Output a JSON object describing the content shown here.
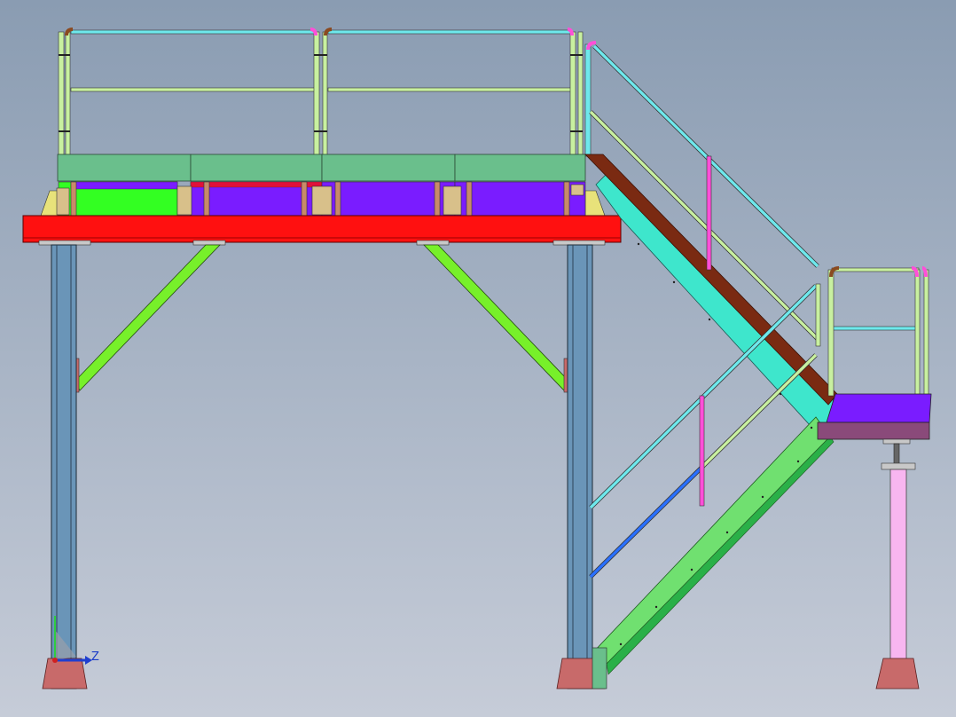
{
  "viewport": {
    "background_top": "#8a9cb2",
    "background_bottom": "#c6ccd8"
  },
  "triad": {
    "z_label": "Z",
    "y_color": "#2ecc40",
    "z_color": "#1f3fd0",
    "origin_color": "#d02020"
  },
  "colors": {
    "main_beam": "#ff1010",
    "column": "#6a95b8",
    "brace": "#77f02a",
    "deck_plate": "#6abf8c",
    "joist_purple": "#7a1cff",
    "joist_green": "#33ff22",
    "stair_stringer_brown": "#7a2a12",
    "stair_stringer_cyan": "#3ee6cc",
    "stair_stringer_green": "#70e070",
    "landing_purple": "#7a1cff",
    "landing_mauve": "#8a4a7a",
    "landing_post": "#f8b6f0",
    "handrail_light": "#c8f0a0",
    "handrail_cyan": "#6ee8ec",
    "handrail_pink": "#ff4fd8",
    "handrail_blue": "#2a70ff",
    "base_plate": "#c86a6a"
  }
}
